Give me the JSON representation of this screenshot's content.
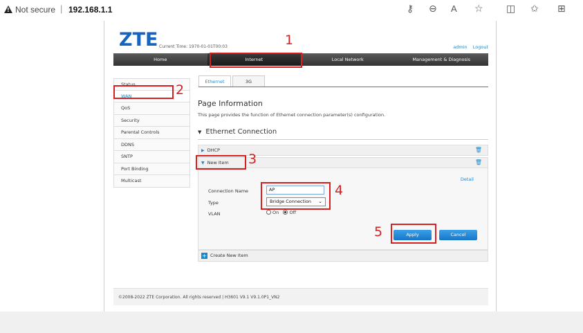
{
  "browser": {
    "security_label": "Not secure",
    "separator": "|",
    "url": "192.168.1.1",
    "icons": [
      "warning-icon",
      "key-icon",
      "zoom-icon",
      "read-aloud-icon",
      "favorite-star-icon",
      "split-screen-icon",
      "favorites-list-icon",
      "collections-icon"
    ]
  },
  "header": {
    "logo": "ZTE",
    "current_time": "Current Time: 1970-01-01T00:03",
    "user": "admin",
    "logout": "Logout"
  },
  "nav": {
    "items": [
      "Home",
      "Internet",
      "Local Network",
      "Management & Diagnosis"
    ],
    "active": "Internet"
  },
  "sidebar": {
    "items": [
      "Status",
      "WAN",
      "QoS",
      "Security",
      "Parental Controls",
      "DDNS",
      "SNTP",
      "Port Binding",
      "Multicast"
    ],
    "active": "WAN"
  },
  "tabs": {
    "items": [
      "Ethernet",
      "3G"
    ],
    "active": "Ethernet"
  },
  "page_info": {
    "title": "Page Information",
    "description": "This page provides the function of Ethernet connection parameter(s) configuration."
  },
  "ethernet": {
    "section_title": "Ethernet Connection",
    "rows": [
      "DHCP",
      "New Item"
    ],
    "detail_link": "Detail",
    "form": {
      "connection_name_label": "Connection Name",
      "connection_name_value": "AP",
      "type_label": "Type",
      "type_value": "Bridge Connection",
      "vlan_label": "VLAN",
      "vlan_on": "On",
      "vlan_off": "Off",
      "vlan_selected": "Off"
    },
    "apply": "Apply",
    "cancel": "Cancel",
    "create_new": "Create New Item"
  },
  "footer": {
    "text": "©2008-2022 ZTE Corporation. All rights reserved  |  H3601 V9.1 V9.1.0P1_VN2"
  },
  "annotations": [
    "1",
    "2",
    "3",
    "4",
    "5"
  ],
  "colors": {
    "accent": "#1e88c8",
    "annotation": "#d81e1e",
    "nav_bg": "#333333"
  }
}
